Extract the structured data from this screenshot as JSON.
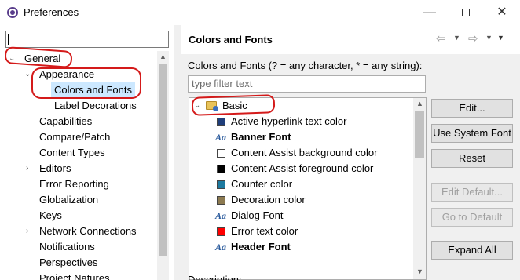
{
  "window": {
    "title": "Preferences",
    "minimize": "—",
    "close": "✕"
  },
  "left_tree": {
    "items": [
      {
        "label": "General",
        "expanded": true
      },
      {
        "label": "Appearance",
        "expanded": true
      },
      {
        "label": "Colors and Fonts",
        "selected": true
      },
      {
        "label": "Label Decorations"
      },
      {
        "label": "Capabilities"
      },
      {
        "label": "Compare/Patch"
      },
      {
        "label": "Content Types"
      },
      {
        "label": "Editors",
        "expandable": true
      },
      {
        "label": "Error Reporting"
      },
      {
        "label": "Globalization"
      },
      {
        "label": "Keys"
      },
      {
        "label": "Network Connections",
        "expandable": true
      },
      {
        "label": "Notifications"
      },
      {
        "label": "Perspectives"
      },
      {
        "label": "Project Natures"
      }
    ]
  },
  "page": {
    "title": "Colors and Fonts",
    "description": "Colors and Fonts (? = any character, * = any string):",
    "filter_placeholder": "type filter text",
    "description_footer": "Description:"
  },
  "list": {
    "group": "Basic",
    "items": [
      {
        "label": "Active hyperlink text color",
        "kind": "color",
        "color": "#1f3e7a"
      },
      {
        "label": "Banner Font",
        "kind": "font",
        "bold": true
      },
      {
        "label": "Content Assist background color",
        "kind": "color",
        "color": "#ffffff"
      },
      {
        "label": "Content Assist foreground color",
        "kind": "color",
        "color": "#000000"
      },
      {
        "label": "Counter color",
        "kind": "color",
        "color": "#1d7aa0"
      },
      {
        "label": "Decoration color",
        "kind": "color",
        "color": "#8c7a50"
      },
      {
        "label": "Dialog Font",
        "kind": "font"
      },
      {
        "label": "Error text color",
        "kind": "color",
        "color": "#ff0000"
      },
      {
        "label": "Header Font",
        "kind": "font",
        "bold": true
      }
    ]
  },
  "buttons": {
    "edit": "Edit...",
    "use_system_font": "Use System Font",
    "reset": "Reset",
    "edit_default": "Edit Default...",
    "go_to_default": "Go to Default",
    "expand_all": "Expand All"
  },
  "icons": {
    "font_glyph": "Aa",
    "back": "⇦",
    "forward": "⇨",
    "dropdown": "▼"
  },
  "colors": {
    "annotation": "#d41a1a",
    "selection": "#cce8ff"
  }
}
